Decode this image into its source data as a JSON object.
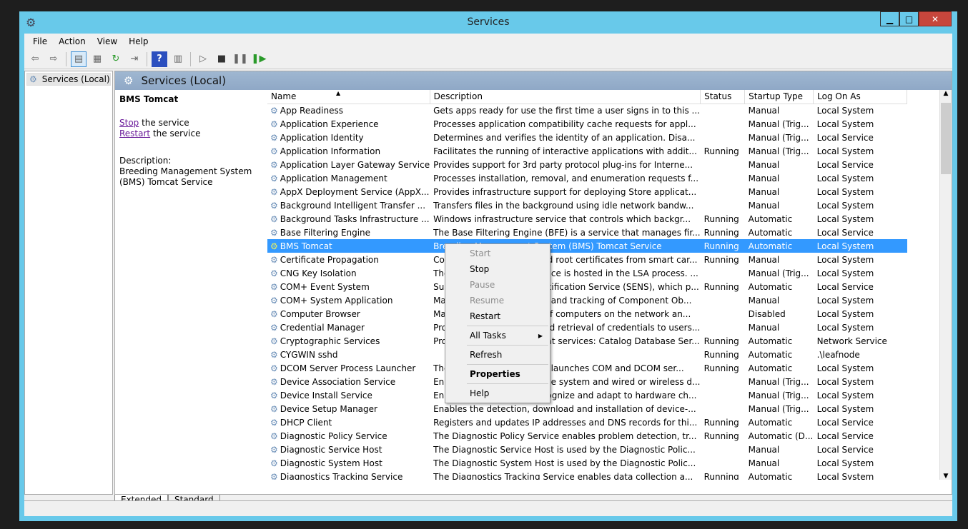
{
  "window": {
    "title": "Services"
  },
  "menubar": [
    "File",
    "Action",
    "View",
    "Help"
  ],
  "tree": {
    "root": "Services (Local)"
  },
  "main": {
    "header": "Services (Local)"
  },
  "details": {
    "service_name": "BMS Tomcat",
    "stop_link": "Stop",
    "stop_suffix": " the service",
    "restart_link": "Restart",
    "restart_suffix": " the service",
    "description_label": "Description:",
    "description": "Breeding Management System (BMS) Tomcat Service"
  },
  "columns": [
    "Name",
    "Description",
    "Status",
    "Startup Type",
    "Log On As"
  ],
  "rows": [
    [
      "App Readiness",
      "Gets apps ready for use the first time a user signs in to this ...",
      "",
      "Manual",
      "Local System"
    ],
    [
      "Application Experience",
      "Processes application compatibility cache requests for appl...",
      "",
      "Manual (Trig...",
      "Local System"
    ],
    [
      "Application Identity",
      "Determines and verifies the identity of an application. Disa...",
      "",
      "Manual (Trig...",
      "Local Service"
    ],
    [
      "Application Information",
      "Facilitates the running of interactive applications with addit...",
      "Running",
      "Manual (Trig...",
      "Local System"
    ],
    [
      "Application Layer Gateway Service",
      "Provides support for 3rd party protocol plug-ins for Interne...",
      "",
      "Manual",
      "Local Service"
    ],
    [
      "Application Management",
      "Processes installation, removal, and enumeration requests f...",
      "",
      "Manual",
      "Local System"
    ],
    [
      "AppX Deployment Service (AppX...",
      "Provides infrastructure support for deploying Store applicat...",
      "",
      "Manual",
      "Local System"
    ],
    [
      "Background Intelligent Transfer ...",
      "Transfers files in the background using idle network bandw...",
      "",
      "Manual",
      "Local System"
    ],
    [
      "Background Tasks Infrastructure ...",
      "Windows infrastructure service that controls which backgr...",
      "Running",
      "Automatic",
      "Local System"
    ],
    [
      "Base Filtering Engine",
      "The Base Filtering Engine (BFE) is a service that manages fir...",
      "Running",
      "Automatic",
      "Local Service"
    ],
    [
      "BMS Tomcat",
      "Breeding Management System (BMS) Tomcat Service",
      "Running",
      "Automatic",
      "Local System"
    ],
    [
      "Certificate Propagation",
      "Copies user certificates and root certificates from smart car...",
      "Running",
      "Manual",
      "Local System"
    ],
    [
      "CNG Key Isolation",
      "The CNG key isolation service is hosted in the LSA process. ...",
      "",
      "Manual (Trig...",
      "Local System"
    ],
    [
      "COM+ Event System",
      "Supports System Event Notification Service (SENS), which p...",
      "Running",
      "Automatic",
      "Local Service"
    ],
    [
      "COM+ System Application",
      "Manages the configuration and tracking of Component Ob...",
      "",
      "Manual",
      "Local System"
    ],
    [
      "Computer Browser",
      "Maintains an updated list of computers on the network an...",
      "",
      "Disabled",
      "Local System"
    ],
    [
      "Credential Manager",
      "Provides secure storage and retrieval of credentials to users...",
      "",
      "Manual",
      "Local System"
    ],
    [
      "Cryptographic Services",
      "Provides three management services: Catalog Database Ser...",
      "Running",
      "Automatic",
      "Network Service"
    ],
    [
      "CYGWIN sshd",
      "",
      "Running",
      "Automatic",
      ".\\leafnode"
    ],
    [
      "DCOM Server Process Launcher",
      "The DCOMLAUNCH service launches COM and DCOM ser...",
      "Running",
      "Automatic",
      "Local System"
    ],
    [
      "Device Association Service",
      "Enables pairing between the system and wired or wireless d...",
      "",
      "Manual (Trig...",
      "Local System"
    ],
    [
      "Device Install Service",
      "Enables a computer to recognize and adapt to hardware ch...",
      "",
      "Manual (Trig...",
      "Local System"
    ],
    [
      "Device Setup Manager",
      "Enables the detection, download and installation of device-...",
      "",
      "Manual (Trig...",
      "Local System"
    ],
    [
      "DHCP Client",
      "Registers and updates IP addresses and DNS records for thi...",
      "Running",
      "Automatic",
      "Local Service"
    ],
    [
      "Diagnostic Policy Service",
      "The Diagnostic Policy Service enables problem detection, tr...",
      "Running",
      "Automatic (D...",
      "Local Service"
    ],
    [
      "Diagnostic Service Host",
      "The Diagnostic Service Host is used by the Diagnostic Polic...",
      "",
      "Manual",
      "Local Service"
    ],
    [
      "Diagnostic System Host",
      "The Diagnostic System Host is used by the Diagnostic Polic...",
      "",
      "Manual",
      "Local System"
    ],
    [
      "Diagnostics Tracking Service",
      "The Diagnostics Tracking Service enables data collection a...",
      "Running",
      "Automatic",
      "Local System"
    ]
  ],
  "selected_row": 10,
  "context_menu": {
    "start": "Start",
    "stop": "Stop",
    "pause": "Pause",
    "resume": "Resume",
    "restart": "Restart",
    "all_tasks": "All Tasks",
    "refresh": "Refresh",
    "properties": "Properties",
    "help": "Help"
  },
  "tabs": [
    "Extended",
    "Standard"
  ],
  "colors": {
    "titlebar": "#68c9ea",
    "selection": "#3399ff",
    "close": "#c7463c"
  }
}
